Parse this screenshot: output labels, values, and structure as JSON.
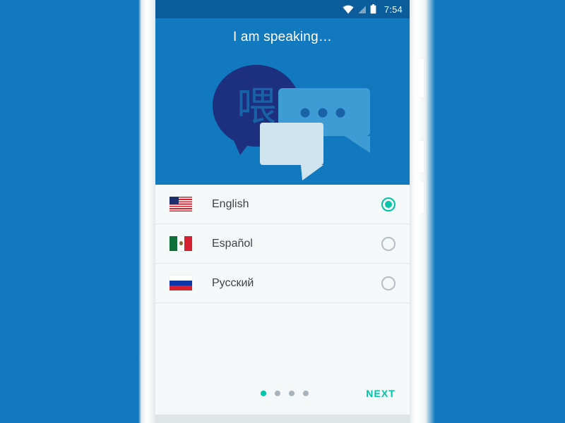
{
  "status_bar": {
    "time": "7:54",
    "icons": [
      "wifi-icon",
      "cellular-signal-icon",
      "battery-icon"
    ]
  },
  "hero": {
    "title": "I am speaking…",
    "illustration": {
      "name": "speech-bubbles-illustration",
      "character": "喂",
      "dots_count": 3,
      "colors": {
        "background": "#1279bf",
        "bubble_back": "#1d3080",
        "bubble_middle": "#3e9bd4",
        "bubble_front": "#cfe4ee"
      }
    }
  },
  "languages": [
    {
      "label": "English",
      "flag": "flag-us-icon",
      "selected": true
    },
    {
      "label": "Español",
      "flag": "flag-mx-icon",
      "selected": false
    },
    {
      "label": "Русский",
      "flag": "flag-ru-icon",
      "selected": false
    }
  ],
  "footer": {
    "next_label": "NEXT",
    "dots": {
      "total": 4,
      "active_index": 0
    }
  },
  "colors": {
    "brand_blue": "#1279bf",
    "status_bar_blue": "#0b5c9b",
    "accent_teal": "#00c4a7",
    "surface": "#f5f8f9",
    "text_primary": "#3e4345",
    "radio_off": "#b5bec3"
  }
}
